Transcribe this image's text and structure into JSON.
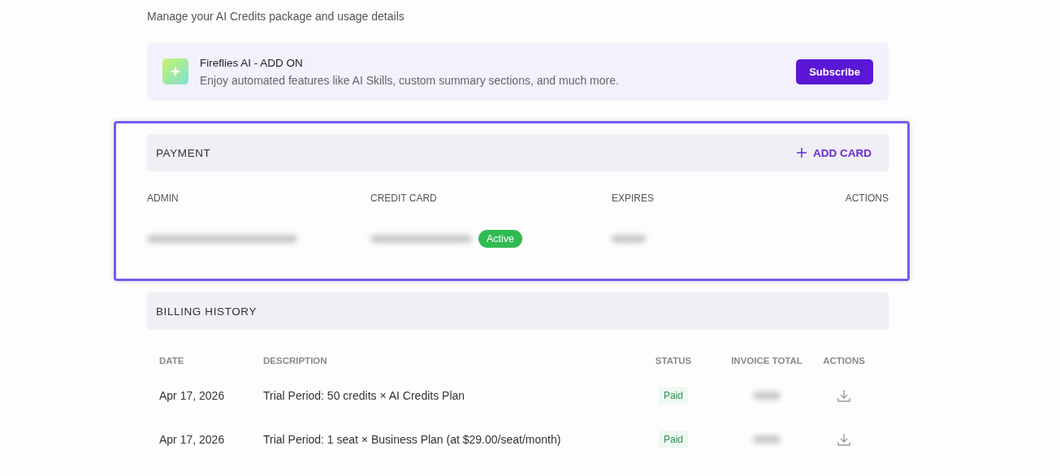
{
  "subtitle": "Manage your AI Credits package and usage details",
  "addon": {
    "title": "Fireflies AI - ADD ON",
    "description": "Enjoy automated features like AI Skills, custom summary sections, and much more.",
    "button": "Subscribe"
  },
  "payment": {
    "title": "PAYMENT",
    "add_button": "ADD CARD",
    "highlighted": true,
    "columns": [
      "ADMIN",
      "CREDIT CARD",
      "EXPIRES",
      "ACTIONS"
    ],
    "rows": [
      {
        "status": "Active"
      }
    ]
  },
  "billing": {
    "title": "BILLING HISTORY",
    "columns": [
      "DATE",
      "DESCRIPTION",
      "STATUS",
      "INVOICE TOTAL",
      "ACTIONS"
    ],
    "rows": [
      {
        "date": "Apr 17, 2026",
        "description": "Trial Period: 50 credits × AI Credits Plan",
        "status": "Paid"
      },
      {
        "date": "Apr 17, 2026",
        "description": "Trial Period: 1 seat × Business Plan (at $29.00/seat/month)",
        "status": "Paid"
      }
    ]
  }
}
